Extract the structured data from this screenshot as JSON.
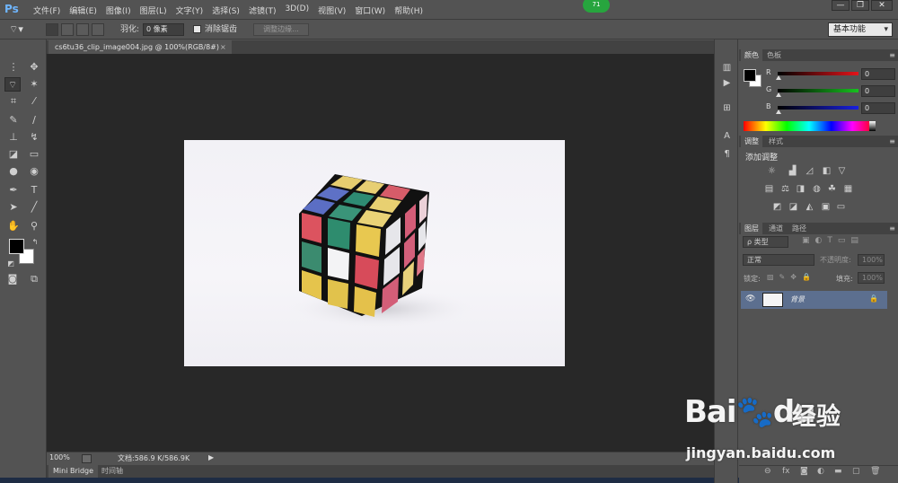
{
  "app": {
    "logo": "Ps",
    "menu": [
      "文件(F)",
      "编辑(E)",
      "图像(I)",
      "图层(L)",
      "文字(Y)",
      "选择(S)",
      "滤镜(T)",
      "3D(D)",
      "视图(V)",
      "窗口(W)",
      "帮助(H)"
    ],
    "badge": "71",
    "window_controls": [
      "—",
      "❐",
      "✕"
    ]
  },
  "options": {
    "feather_label": "羽化:",
    "feather_value": "0 像素",
    "antialias_label": "消除锯齿",
    "antialias_checked": true,
    "refine_edge_label": "调整边缘...",
    "workspace": "基本功能"
  },
  "document": {
    "tab_label": "cs6tu36_clip_image004.jpg @ 100%(RGB/8#)",
    "tab_close": "×",
    "zoom": "100%",
    "doc_info": "文档:586.9 K/586.9K",
    "status_arrow": "▶"
  },
  "bottom_tabs": [
    "Mini Bridge",
    "时间轴"
  ],
  "color_panel": {
    "tabs": [
      "颜色",
      "色板"
    ],
    "channels": [
      {
        "label": "R",
        "value": "0",
        "color": "#c8201f"
      },
      {
        "label": "G",
        "value": "0",
        "color": "#1f9a28"
      },
      {
        "label": "B",
        "value": "0",
        "color": "#1d24a6"
      }
    ]
  },
  "adjustments_panel": {
    "tabs": [
      "调整",
      "样式"
    ],
    "title": "添加调整"
  },
  "layers_panel": {
    "tabs": [
      "图层",
      "通道",
      "路径"
    ],
    "filter_label": "ρ 类型",
    "blend_mode": "正常",
    "opacity_label": "不透明度:",
    "opacity_value": "100%",
    "lock_label": "锁定:",
    "fill_label": "填充:",
    "fill_value": "100%",
    "layers": [
      {
        "name": "背景",
        "visible": true,
        "locked": true
      }
    ]
  },
  "watermark": {
    "brand": "Bai",
    "brand_suffix": "du",
    "cn": "经验",
    "url": "jingyan.baidu.com"
  },
  "colors": {
    "cube_red": "#d8505c",
    "cube_blue": "#5a6fc2",
    "cube_yellow": "#e8cf72",
    "cube_green": "#2e8a70",
    "cube_white": "#f2f2f2",
    "cube_pink": "#d8607a",
    "cube_yellow2": "#e6c24a"
  }
}
